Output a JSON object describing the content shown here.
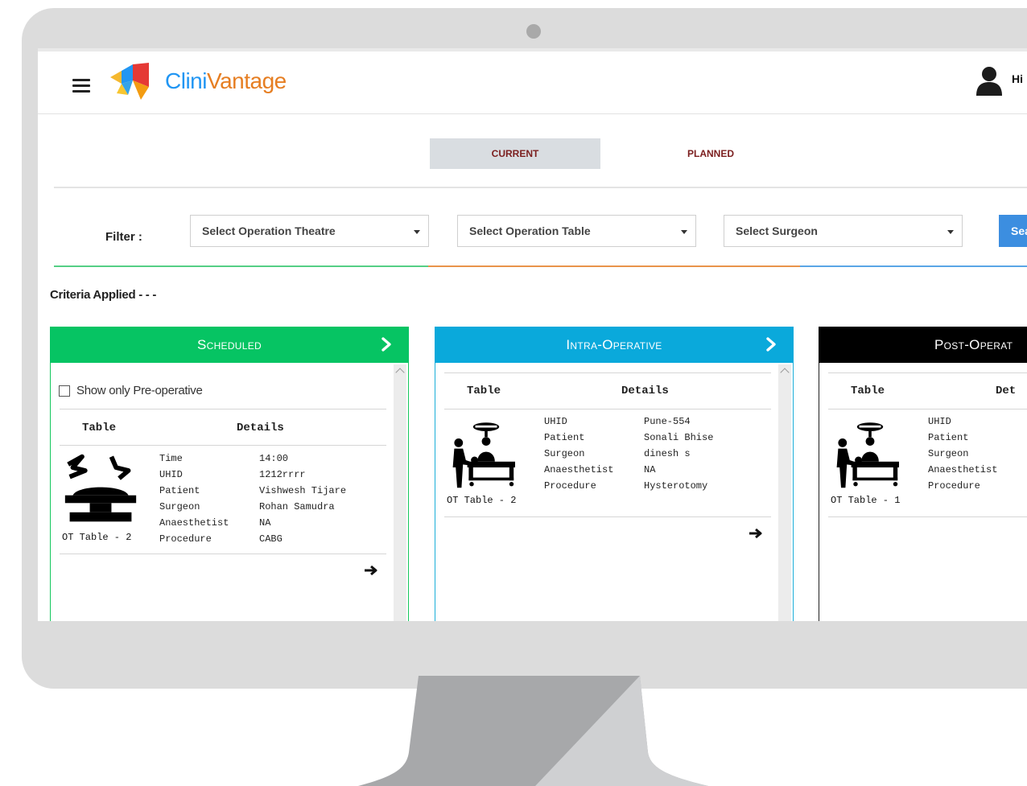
{
  "header": {
    "logo_text_part1": "Clini",
    "logo_text_part2": "Vantage",
    "user_greeting": "Hi"
  },
  "tabs": [
    {
      "label": "Current",
      "active": true
    },
    {
      "label": "Planned",
      "active": false
    }
  ],
  "filter": {
    "label": "Filter :",
    "operation_theatre": "Select Operation Theatre",
    "operation_table": "Select Operation Table",
    "surgeon": "Select Surgeon",
    "search_button": "Sea"
  },
  "criteria": "Criteria Applied - - -",
  "panels": {
    "scheduled": {
      "title": "Scheduled",
      "color": "#06c463",
      "show_only_label": "Show only Pre-operative",
      "col_table": "Table",
      "col_details": "Details",
      "ot_label": "OT Table - 2",
      "rows": [
        {
          "k": "Time",
          "v": "14:00"
        },
        {
          "k": "UHID",
          "v": "1212rrrr"
        },
        {
          "k": "Patient",
          "v": "Vishwesh Tijare"
        },
        {
          "k": "Surgeon",
          "v": "Rohan Samudra"
        },
        {
          "k": "Anaesthetist",
          "v": "NA"
        },
        {
          "k": "Procedure",
          "v": "CABG"
        }
      ]
    },
    "intra": {
      "title": "Intra-Operative",
      "color": "#0aa9db",
      "col_table": "Table",
      "col_details": "Details",
      "ot_label": "OT Table - 2",
      "rows": [
        {
          "k": "UHID",
          "v": "Pune-554"
        },
        {
          "k": "Patient",
          "v": "Sonali Bhise"
        },
        {
          "k": "Surgeon",
          "v": "dinesh s"
        },
        {
          "k": "Anaesthetist",
          "v": "NA"
        },
        {
          "k": "Procedure",
          "v": "Hysterotomy"
        }
      ]
    },
    "post": {
      "title": "Post-Operat",
      "color": "#000000",
      "col_table": "Table",
      "col_details": "Det",
      "ot_label": "OT Table - 1",
      "rows": [
        {
          "k": "UHID",
          "v": ""
        },
        {
          "k": "Patient",
          "v": ""
        },
        {
          "k": "Surgeon",
          "v": ""
        },
        {
          "k": "Anaesthetist",
          "v": ""
        },
        {
          "k": "Procedure",
          "v": ""
        }
      ]
    }
  },
  "icons": {
    "menu": "hamburger-icon",
    "user": "user-icon",
    "nav": "chevron-right-icon",
    "go": "arrow-right-icon",
    "table": "operation-table-icon",
    "surgery": "surgery-in-progress-icon"
  }
}
